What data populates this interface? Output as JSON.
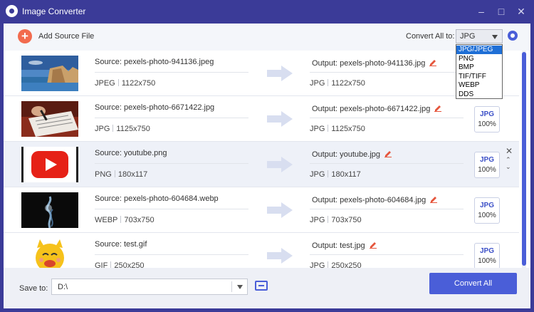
{
  "window": {
    "title": "Image Converter",
    "controls": [
      "minimize-icon",
      "maximize-icon",
      "close-icon"
    ]
  },
  "toolbar": {
    "add_label": "Add Source File",
    "convert_all_label": "Convert All to:",
    "selected_format": "JPG"
  },
  "dropdown": {
    "options": [
      "JPG/JPEG",
      "PNG",
      "BMP",
      "TIF/TIFF",
      "WEBP",
      "DDS"
    ],
    "highlighted": "JPG/JPEG"
  },
  "files": [
    {
      "source": "Source: pexels-photo-941136.jpeg",
      "src_format": "JPEG",
      "src_size": "1122x750",
      "output": "Output: pexels-photo-941136.jpg",
      "out_format": "JPG",
      "out_size": "1122x750",
      "badge_format": "",
      "badge_pct": "",
      "selected": false
    },
    {
      "source": "Source: pexels-photo-6671422.jpg",
      "src_format": "JPG",
      "src_size": "1125x750",
      "output": "Output: pexels-photo-6671422.jpg",
      "out_format": "JPG",
      "out_size": "1125x750",
      "badge_format": "JPG",
      "badge_pct": "100%",
      "selected": false
    },
    {
      "source": "Source: youtube.png",
      "src_format": "PNG",
      "src_size": "180x117",
      "output": "Output: youtube.jpg",
      "out_format": "JPG",
      "out_size": "180x117",
      "badge_format": "JPG",
      "badge_pct": "100%",
      "selected": true
    },
    {
      "source": "Source: pexels-photo-604684.webp",
      "src_format": "WEBP",
      "src_size": "703x750",
      "output": "Output: pexels-photo-604684.jpg",
      "out_format": "JPG",
      "out_size": "703x750",
      "badge_format": "JPG",
      "badge_pct": "100%",
      "selected": false
    },
    {
      "source": "Source: test.gif",
      "src_format": "GIF",
      "src_size": "250x250",
      "output": "Output: test.jpg",
      "out_format": "JPG",
      "out_size": "250x250",
      "badge_format": "JPG",
      "badge_pct": "100%",
      "selected": false
    }
  ],
  "footer": {
    "save_label": "Save to:",
    "path": "D:\\",
    "convert_button": "Convert All"
  },
  "colors": {
    "titlebar": "#3b3b98",
    "accent": "#4a5ed8",
    "add_icon": "#f26b4e",
    "edit_icon": "#e5553c"
  }
}
